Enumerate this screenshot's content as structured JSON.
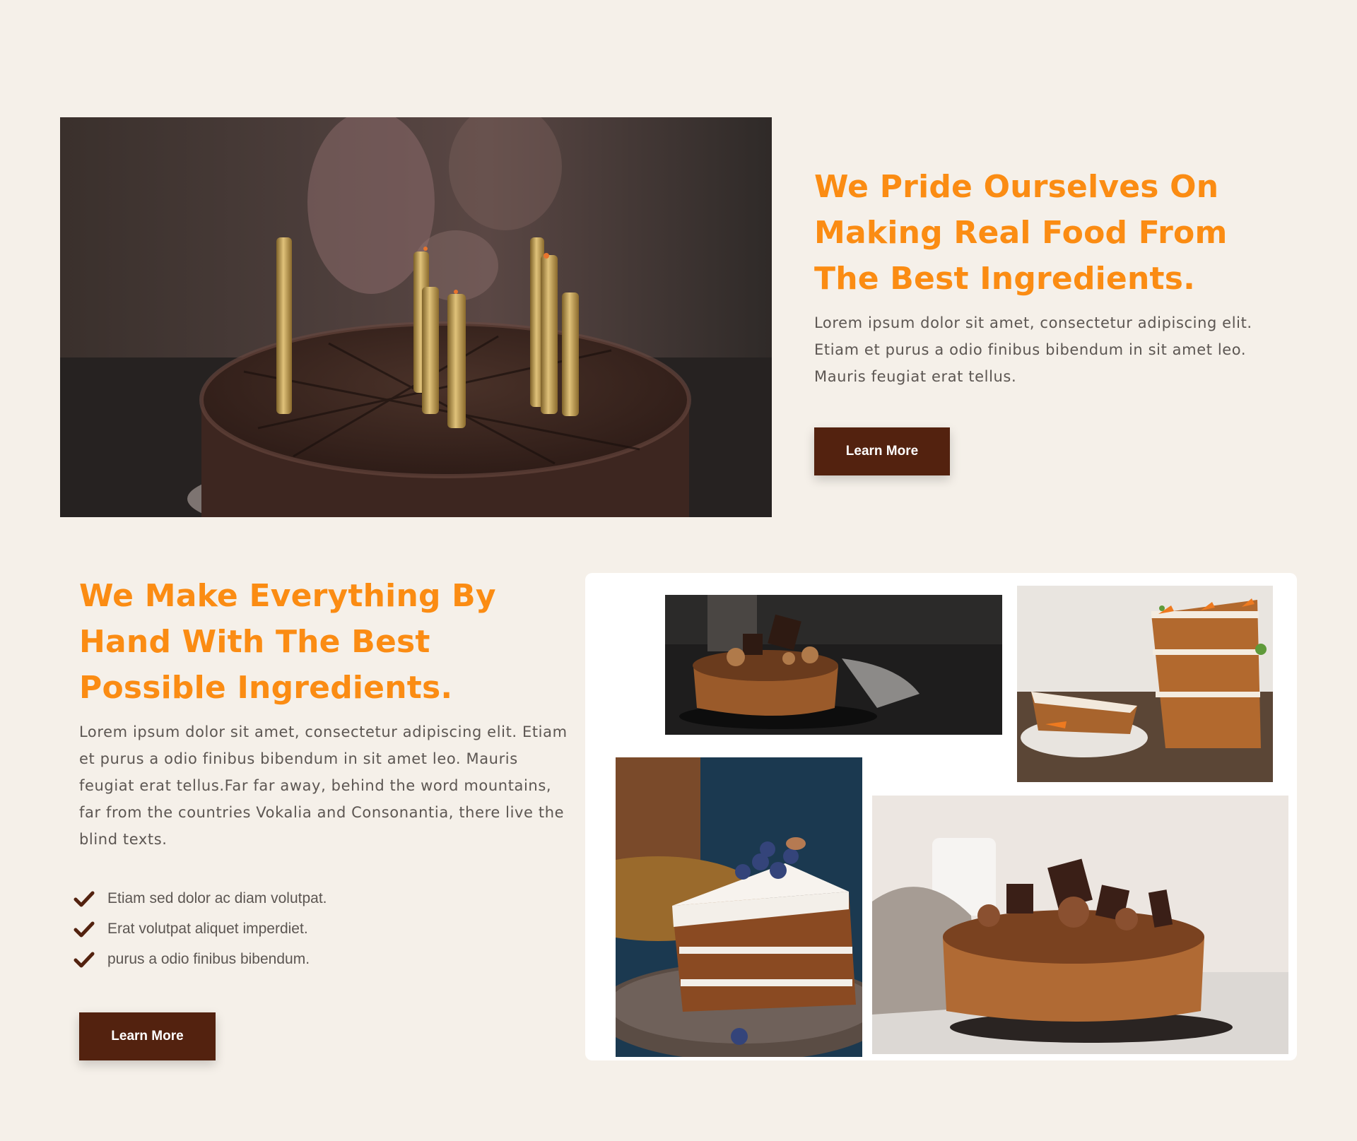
{
  "section_pride": {
    "image": "chocolate-birthday-cake-with-candles",
    "heading": "We Pride Ourselves On Making Real Food From The Best Ingredients.",
    "body": "Lorem ipsum dolor sit amet, consectetur adipiscing elit. Etiam et purus a odio finibus bibendum in sit amet leo. Mauris feugiat erat tellus.",
    "button_label": "Learn More"
  },
  "section_handmade": {
    "heading": "We Make Everything By Hand With The Best Possible Ingredients.",
    "body": "Lorem ipsum dolor sit amet, consectetur adipiscing elit. Etiam et purus a odio finibus bibendum in sit amet leo. Mauris feugiat erat tellus.Far far away, behind the word mountains, far from the countries Vokalia and Consonantia, there live the blind texts.",
    "checklist": [
      "Etiam sed dolor ac diam volutpat.",
      "Erat volutpat aliquet imperdiet.",
      "purus a odio finibus bibendum."
    ],
    "button_label": "Learn More",
    "gallery": [
      "chocolate-truffle-cake-dark-background",
      "carrot-cake-slices",
      "carrot-cake-slice-with-blueberries",
      "chocolate-crumb-cake-on-board"
    ]
  },
  "colors": {
    "background": "#f5f0e9",
    "heading": "#fb8c13",
    "body_text": "#5c5652",
    "button": "#53220f",
    "check_icon": "#53220f"
  },
  "icons": {
    "check": "check-icon"
  }
}
